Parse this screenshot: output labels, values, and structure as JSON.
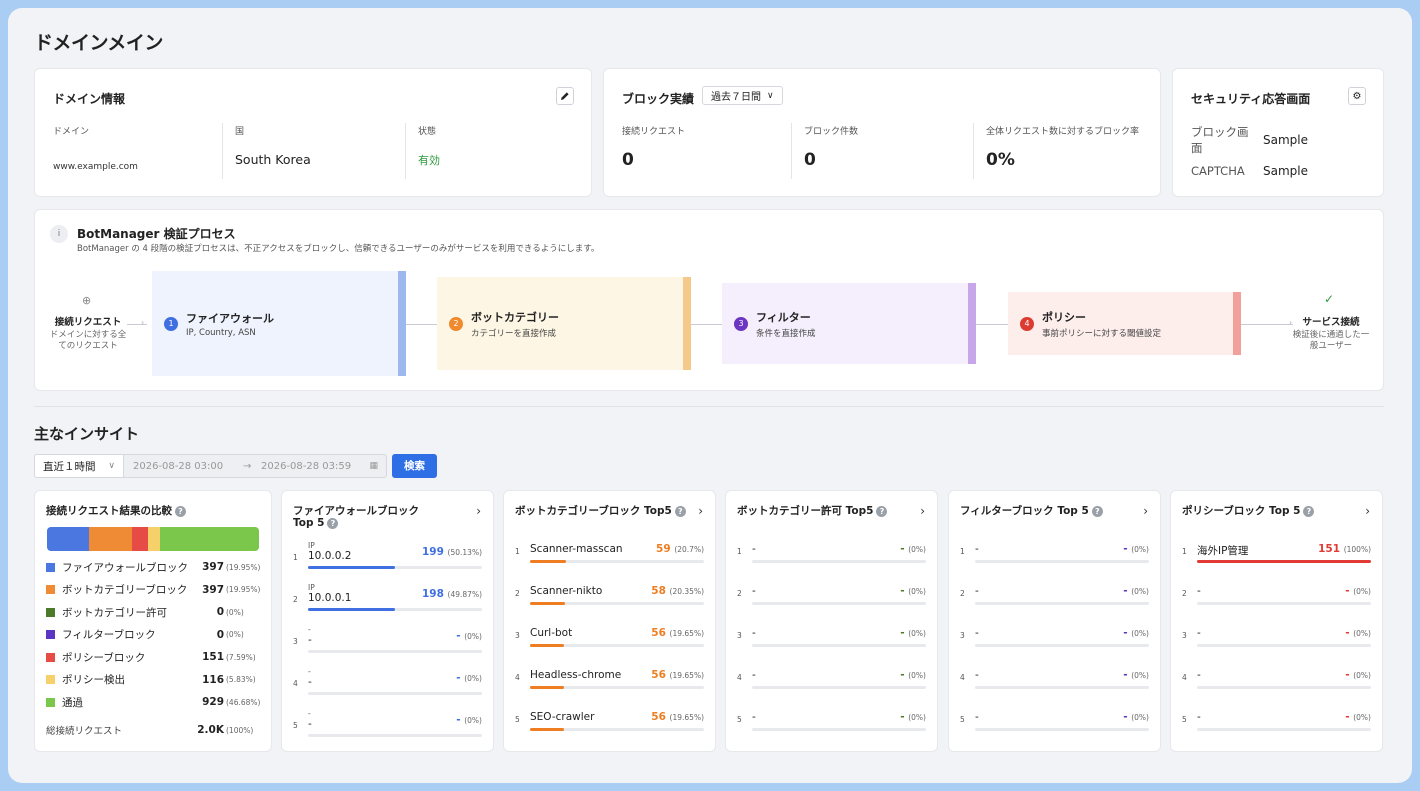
{
  "page": {
    "title": "ドメインメイン"
  },
  "domain_info": {
    "title": "ドメイン情報",
    "edit_icon": "pencil-icon",
    "domain_label": "ドメイン",
    "domain_value": "www.example.com",
    "country_label": "国",
    "country_value": "South Korea",
    "status_label": "状態",
    "status_value": "有効",
    "status_color": "#2e9a3e"
  },
  "block_stats": {
    "title": "ブロック実績",
    "period": "過去７日間",
    "req_label": "接続リクエスト",
    "req_value": "0",
    "block_label": "ブロック件数",
    "block_value": "0",
    "rate_label": "全体リクエスト数に対するブロック率",
    "rate_value": "0%"
  },
  "security": {
    "title": "セキュリティ応答画面",
    "settings_icon": "gear-icon",
    "block_label": "ブロック画面",
    "block_value": "Sample",
    "captcha_label": "CAPTCHA",
    "captcha_value": "Sample"
  },
  "process": {
    "title": "BotManager 検証プロセス",
    "desc": "BotManager の 4 段階の検証プロセスは、不正アクセスをブロックし、信頼できるユーザーのみがサービスを利用できるようにします。",
    "start_name": "接続リクエスト",
    "start_desc": "ドメインに対する全てのリクエスト",
    "end_name": "サービス接続",
    "end_desc": "検証後に通過した一般ユーザー",
    "stages": [
      {
        "num": "1",
        "name": "ファイアウォール",
        "desc": "IP, Country, ASN",
        "bg": "#eef3fd",
        "accent": "#9db8ee",
        "dot": "#3f6fe0"
      },
      {
        "num": "2",
        "name": "ボットカテゴリー",
        "desc": "カテゴリーを直接作成",
        "bg": "#fdf6e4",
        "accent": "#f5c98a",
        "dot": "#ef8a2e"
      },
      {
        "num": "3",
        "name": "フィルター",
        "desc": "条件を直接作成",
        "bg": "#f5effd",
        "accent": "#c7a7ea",
        "dot": "#6c35c2"
      },
      {
        "num": "4",
        "name": "ポリシー",
        "desc": "事前ポリシーに対する閾値設定",
        "bg": "#fdeeec",
        "accent": "#f2a19a",
        "dot": "#dc3b32"
      }
    ]
  },
  "insights": {
    "title": "主なインサイト",
    "range": "直近１時間",
    "from": "2026-08-28 03:00",
    "arrow": "→",
    "to": "2026-08-28 03:59",
    "search": "検索"
  },
  "compare": {
    "title": "接続リクエスト結果の比較",
    "items": [
      {
        "name": "ファイアウォールブロック",
        "value": "397",
        "pct": "(19.95%)",
        "color": "#4a78e0",
        "share": 19.95
      },
      {
        "name": "ボットカテゴリーブロック",
        "value": "397",
        "pct": "(19.95%)",
        "color": "#ef8a35",
        "share": 19.95
      },
      {
        "name": "ボットカテゴリー許可",
        "value": "0",
        "pct": "(0%)",
        "color": "#4a7a2a",
        "share": 0
      },
      {
        "name": "フィルターブロック",
        "value": "0",
        "pct": "(0%)",
        "color": "#5b36c2",
        "share": 0
      },
      {
        "name": "ポリシーブロック",
        "value": "151",
        "pct": "(7.59%)",
        "color": "#e64c45",
        "share": 7.59
      },
      {
        "name": "ポリシー検出",
        "value": "116",
        "pct": "(5.83%)",
        "color": "#f6d069",
        "share": 5.83
      },
      {
        "name": "通過",
        "value": "929",
        "pct": "(46.68%)",
        "color": "#7ac74b",
        "share": 46.68
      }
    ],
    "total_label": "総接続リクエスト",
    "total_value": "2.0K",
    "total_pct": "(100%)"
  },
  "top_cards": [
    {
      "title": "ファイアウォールブロック Top 5",
      "color": "#3f6fe0",
      "rows": [
        {
          "rank": "1",
          "sub": "IP",
          "name": "10.0.0.2",
          "value": "199",
          "pct": "(50.13%)",
          "ratio": 0.5013
        },
        {
          "rank": "2",
          "sub": "IP",
          "name": "10.0.0.1",
          "value": "198",
          "pct": "(49.87%)",
          "ratio": 0.4987
        },
        {
          "rank": "3",
          "sub": "-",
          "name": "-",
          "value": "-",
          "pct": "(0%)",
          "ratio": 0
        },
        {
          "rank": "4",
          "sub": "-",
          "name": "-",
          "value": "-",
          "pct": "(0%)",
          "ratio": 0
        },
        {
          "rank": "5",
          "sub": "-",
          "name": "-",
          "value": "-",
          "pct": "(0%)",
          "ratio": 0
        }
      ]
    },
    {
      "title": "ボットカテゴリーブロック Top5",
      "color": "#ef7e22",
      "rows": [
        {
          "rank": "1",
          "sub": "",
          "name": "Scanner-masscan",
          "value": "59",
          "pct": "(20.7%)",
          "ratio": 0.207
        },
        {
          "rank": "2",
          "sub": "",
          "name": "Scanner-nikto",
          "value": "58",
          "pct": "(20.35%)",
          "ratio": 0.2035
        },
        {
          "rank": "3",
          "sub": "",
          "name": "Curl-bot",
          "value": "56",
          "pct": "(19.65%)",
          "ratio": 0.1965
        },
        {
          "rank": "4",
          "sub": "",
          "name": "Headless-chrome",
          "value": "56",
          "pct": "(19.65%)",
          "ratio": 0.1965
        },
        {
          "rank": "5",
          "sub": "",
          "name": "SEO-crawler",
          "value": "56",
          "pct": "(19.65%)",
          "ratio": 0.1965
        }
      ]
    },
    {
      "title": "ボットカテゴリー許可 Top5",
      "color": "#4a7a2a",
      "rows": [
        {
          "rank": "1",
          "sub": "",
          "name": "-",
          "value": "-",
          "pct": "(0%)",
          "ratio": 0
        },
        {
          "rank": "2",
          "sub": "",
          "name": "-",
          "value": "-",
          "pct": "(0%)",
          "ratio": 0
        },
        {
          "rank": "3",
          "sub": "",
          "name": "-",
          "value": "-",
          "pct": "(0%)",
          "ratio": 0
        },
        {
          "rank": "4",
          "sub": "",
          "name": "-",
          "value": "-",
          "pct": "(0%)",
          "ratio": 0
        },
        {
          "rank": "5",
          "sub": "",
          "name": "-",
          "value": "-",
          "pct": "(0%)",
          "ratio": 0
        }
      ]
    },
    {
      "title": "フィルターブロック Top 5",
      "color": "#5b36c2",
      "rows": [
        {
          "rank": "1",
          "sub": "",
          "name": "-",
          "value": "-",
          "pct": "(0%)",
          "ratio": 0
        },
        {
          "rank": "2",
          "sub": "",
          "name": "-",
          "value": "-",
          "pct": "(0%)",
          "ratio": 0
        },
        {
          "rank": "3",
          "sub": "",
          "name": "-",
          "value": "-",
          "pct": "(0%)",
          "ratio": 0
        },
        {
          "rank": "4",
          "sub": "",
          "name": "-",
          "value": "-",
          "pct": "(0%)",
          "ratio": 0
        },
        {
          "rank": "5",
          "sub": "",
          "name": "-",
          "value": "-",
          "pct": "(0%)",
          "ratio": 0
        }
      ]
    },
    {
      "title": "ポリシーブロック Top 5",
      "color": "#e23b35",
      "rows": [
        {
          "rank": "1",
          "sub": "",
          "name": "海外IP管理",
          "value": "151",
          "pct": "(100%)",
          "ratio": 1
        },
        {
          "rank": "2",
          "sub": "",
          "name": "-",
          "value": "-",
          "pct": "(0%)",
          "ratio": 0
        },
        {
          "rank": "3",
          "sub": "",
          "name": "-",
          "value": "-",
          "pct": "(0%)",
          "ratio": 0
        },
        {
          "rank": "4",
          "sub": "",
          "name": "-",
          "value": "-",
          "pct": "(0%)",
          "ratio": 0
        },
        {
          "rank": "5",
          "sub": "",
          "name": "-",
          "value": "-",
          "pct": "(0%)",
          "ratio": 0
        }
      ]
    }
  ]
}
